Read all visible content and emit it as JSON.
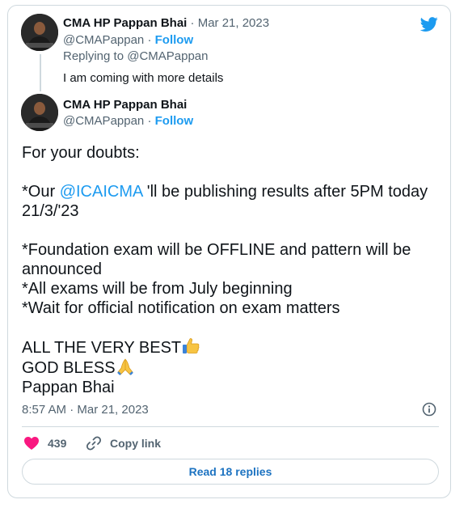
{
  "parent_tweet": {
    "author_name": "CMA HP Pappan Bhai",
    "date": "· Mar 21, 2023",
    "handle": "@CMAPappan ·",
    "follow_label": "Follow",
    "replying_to": "Replying to @CMAPappan",
    "text": "I am coming with more details"
  },
  "main_tweet": {
    "author_name": "CMA HP Pappan Bhai",
    "handle": "@CMAPappan ·",
    "follow_label": "Follow",
    "lines": {
      "l1": "For your doubts:",
      "l2_prefix": "*Our ",
      "l2_mention": "@ICAICMA",
      "l2_suffix": " 'll be  publishing results after 5PM today 21/3/'23",
      "l3": "*Foundation exam will be OFFLINE and pattern will be announced",
      "l4": "*All exams will be from July beginning",
      "l5": "*Wait for official notification on exam matters",
      "l6": "ALL THE VERY BEST",
      "l7": "GOD BLESS",
      "l8": "Pappan Bhai"
    },
    "timestamp": "8:57 AM · Mar 21, 2023"
  },
  "actions": {
    "like_count": "439",
    "copy_link_label": "Copy link"
  },
  "read_replies_label": "Read 18 replies",
  "colors": {
    "accent": "#1d9bf0",
    "like": "#f91880",
    "muted": "#536471",
    "border": "#cfd9de"
  },
  "icons": [
    "twitter-bird-icon",
    "info-icon",
    "heart-icon",
    "link-icon",
    "thumbs-up-emoji",
    "folded-hands-emoji"
  ]
}
